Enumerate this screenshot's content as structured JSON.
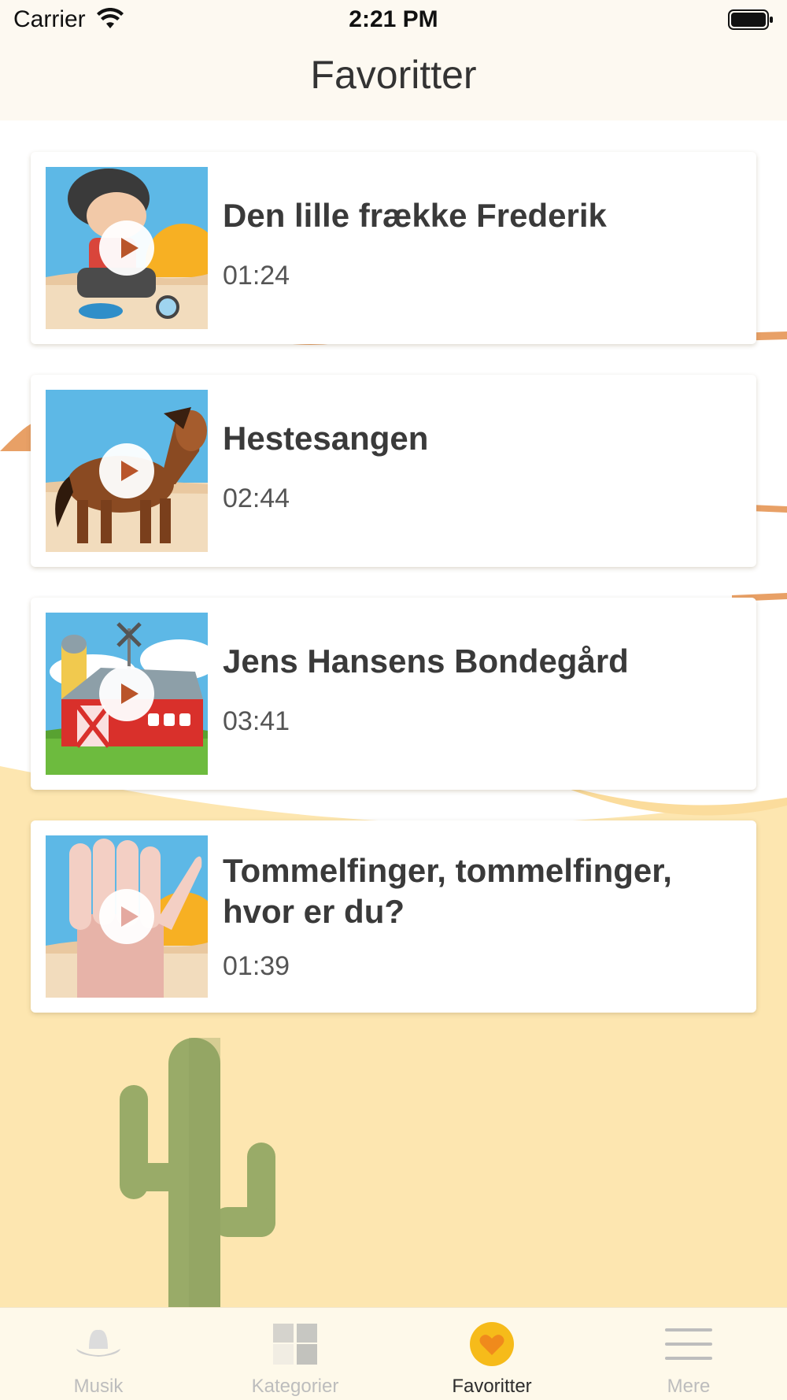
{
  "status_bar": {
    "carrier": "Carrier",
    "time": "2:21 PM",
    "wifi_icon": "wifi-icon",
    "battery_icon": "battery-full-icon"
  },
  "nav": {
    "title": "Favoritter"
  },
  "songs": [
    {
      "title": "Den lille frække Frederik",
      "duration": "01:24",
      "thumbnail_icon": "boy-with-magnifier-illustration",
      "play_icon": "play-icon"
    },
    {
      "title": "Hestesangen",
      "duration": "02:44",
      "thumbnail_icon": "horse-illustration",
      "play_icon": "play-icon"
    },
    {
      "title": "Jens Hansens Bondegård",
      "duration": "03:41",
      "thumbnail_icon": "red-barn-illustration",
      "play_icon": "play-icon"
    },
    {
      "title": "Tommelfinger, tommelfinger, hvor er du?",
      "duration": "01:39",
      "thumbnail_icon": "hand-thumb-illustration",
      "play_icon": "play-icon"
    }
  ],
  "tab_bar": {
    "tabs": [
      {
        "label": "Musik",
        "icon": "cowboy-hat-icon",
        "active": false
      },
      {
        "label": "Kategorier",
        "icon": "grid-icon",
        "active": false
      },
      {
        "label": "Favoritter",
        "icon": "heart-icon",
        "active": true
      },
      {
        "label": "Mere",
        "icon": "menu-icon",
        "active": false
      }
    ]
  },
  "colors": {
    "accent": "#f6bb1a",
    "heart": "#f08a1c",
    "sand": "#fde6b0",
    "sun": "#e8a066",
    "cactus": "#99ab68",
    "header_bg": "#fdf9f1"
  }
}
